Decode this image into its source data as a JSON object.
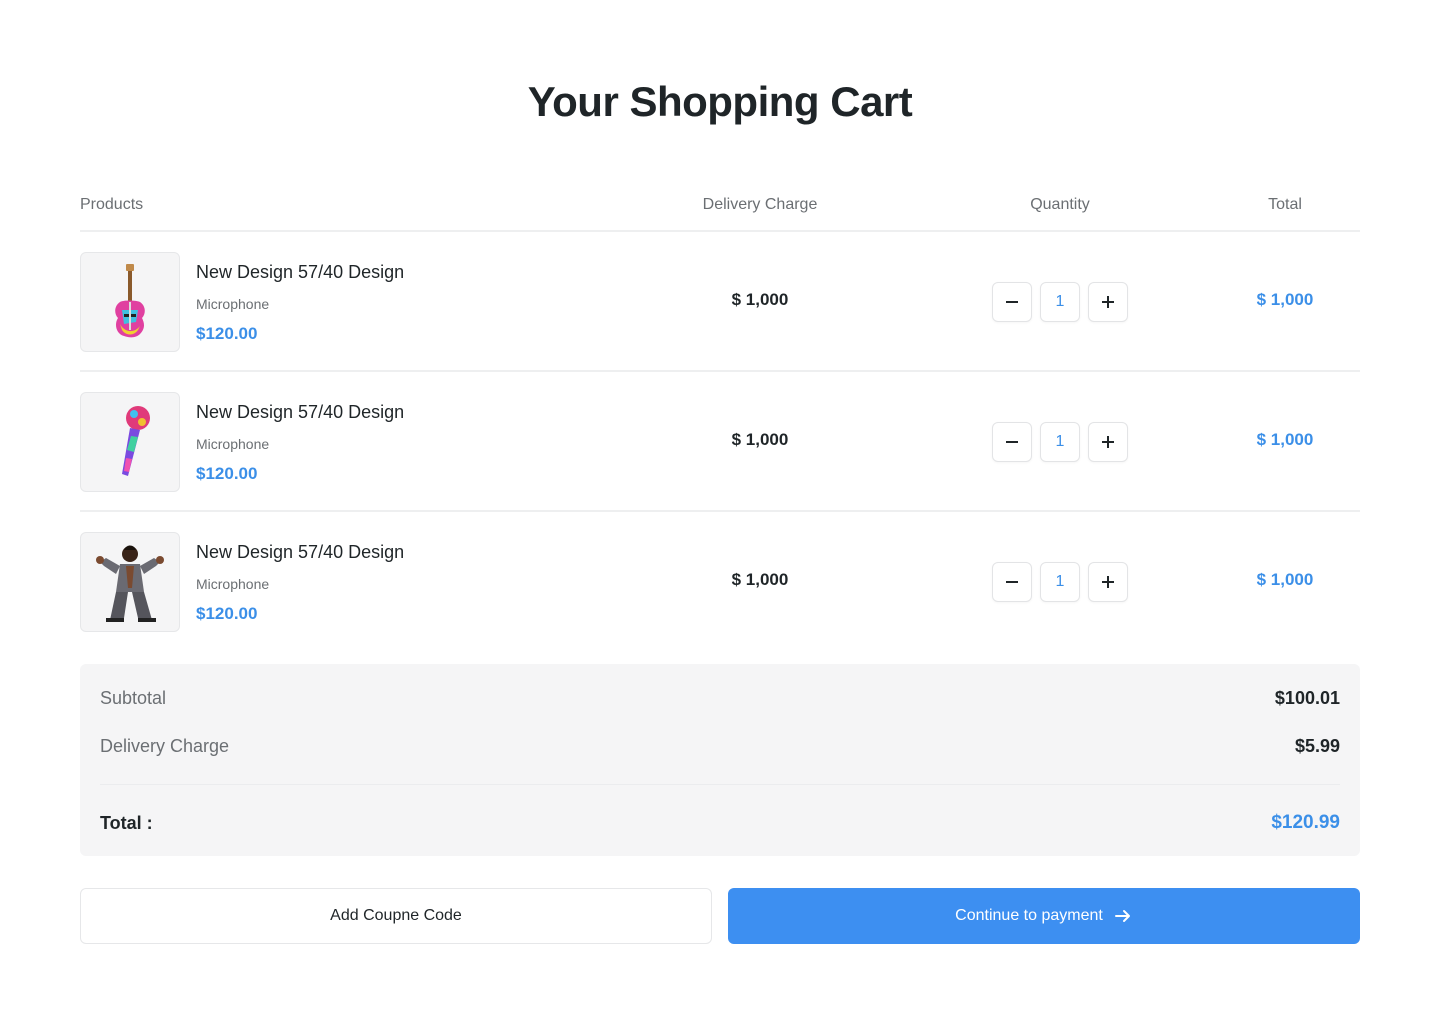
{
  "page": {
    "title": "Your Shopping Cart"
  },
  "table": {
    "headers": {
      "products": "Products",
      "delivery": "Delivery Charge",
      "quantity": "Quantity",
      "total": "Total"
    },
    "items": [
      {
        "name": "New Design 57/40 Design",
        "category": "Microphone",
        "price": "$120.00",
        "delivery": "$ 1,000",
        "quantity": "1",
        "total": "$ 1,000",
        "image": "electric-guitar-image"
      },
      {
        "name": "New Design 57/40 Design",
        "category": "Microphone",
        "price": "$120.00",
        "delivery": "$ 1,000",
        "quantity": "1",
        "total": "$ 1,000",
        "image": "microphone-image"
      },
      {
        "name": "New Design 57/40 Design",
        "category": "Microphone",
        "price": "$120.00",
        "delivery": "$ 1,000",
        "quantity": "1",
        "total": "$ 1,000",
        "image": "singer-image"
      }
    ]
  },
  "summary": {
    "subtotal_label": "Subtotal",
    "subtotal_value": "$100.01",
    "delivery_label": "Delivery Charge",
    "delivery_value": "$5.99",
    "total_label": "Total :",
    "total_value": "$120.99"
  },
  "actions": {
    "coupon_label": "Add Coupne Code",
    "pay_label": "Continue to payment",
    "pay_icon": "arrow-right-icon"
  },
  "colors": {
    "accent": "#3d8ff1",
    "price_text": "#3b8fe8",
    "heading_text": "#1f2528",
    "muted_text": "#6b6f73",
    "summary_bg": "#f5f5f6"
  }
}
